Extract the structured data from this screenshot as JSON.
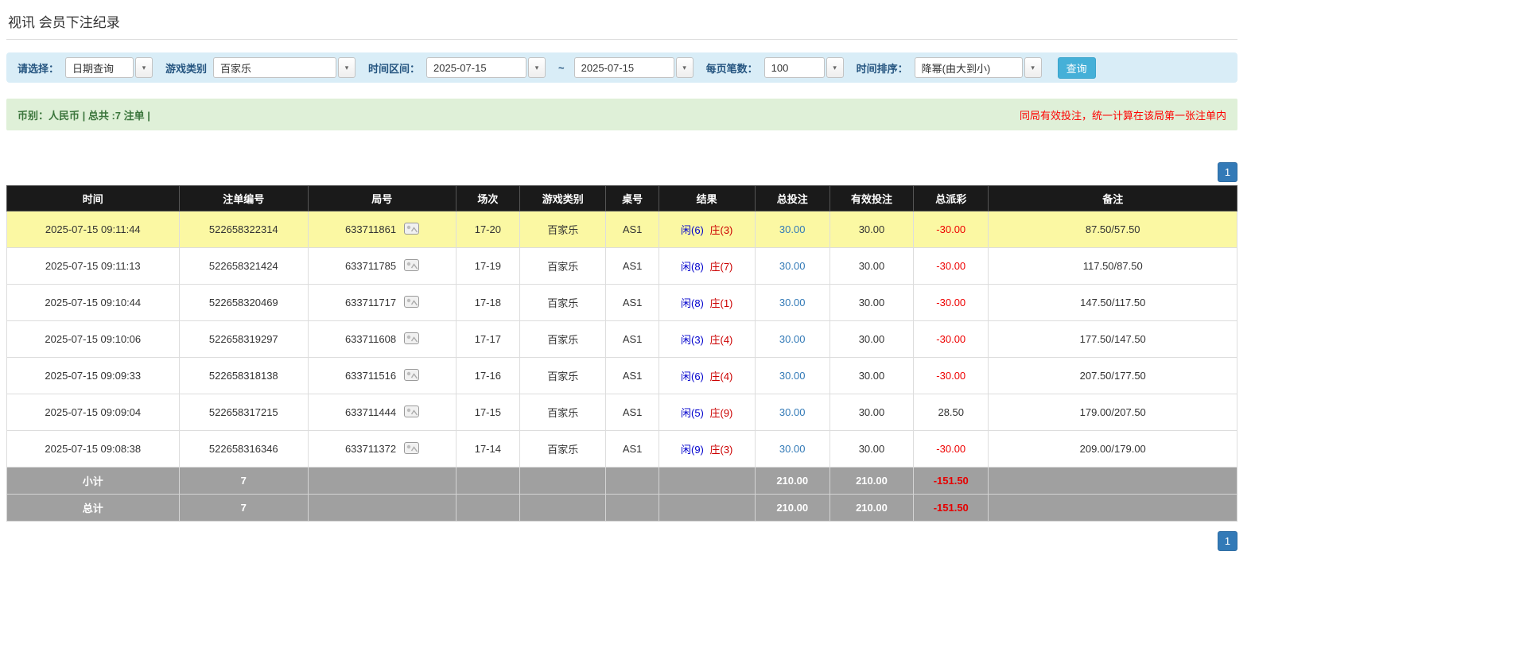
{
  "page": {
    "title": "视讯 会员下注纪录"
  },
  "icons": {
    "combo_arrow": "▾",
    "round_result_icon": "game-result-icon"
  },
  "filters": {
    "select_label": "请选择：",
    "select_value": "日期查询",
    "game_type_label": "游戏类别",
    "game_type_value": "百家乐",
    "date_range_label": "时间区间：",
    "date_from": "2025-07-15",
    "date_separator": "~",
    "date_to": "2025-07-15",
    "page_size_label": "每页笔数：",
    "page_size_value": "100",
    "sort_label": "时间排序：",
    "sort_value": "降幂(由大到小)",
    "search_button_label": "查询"
  },
  "summary_bar": {
    "left_text": "币别：人民币 | 总共 :7 注单 |",
    "right_text": "同局有效投注，统一计算在该局第一张注单内"
  },
  "pagination": {
    "top_page": "1",
    "bottom_page": "1"
  },
  "colors": {
    "filter_bar_bg": "#d9edf7",
    "summary_bar_bg": "#dff0d8",
    "summary_text_green": "#3c763d",
    "notice_red": "#ff0000",
    "header_bg": "#1a1a1a",
    "highlight_row": "#fbf8a3",
    "footer_gray": "#a0a0a0",
    "link_blue": "#337ab7",
    "player_blue": "#0000cc",
    "banker_red": "#cc0000",
    "negative_red": "#ee0000",
    "search_button_blue": "#45b0d8",
    "pagination_blue": "#337ab7"
  },
  "table": {
    "headers": [
      "时间",
      "注单编号",
      "局号",
      "场次",
      "游戏类别",
      "桌号",
      "结果",
      "总投注",
      "有效投注",
      "总派彩",
      "备注"
    ],
    "rows": [
      {
        "time": "2025-07-15 09:11:44",
        "bet_id": "522658322314",
        "round_id": "633711861",
        "session": "17-20",
        "game": "百家乐",
        "table_no": "AS1",
        "result_player": "闲(6)",
        "result_banker": "庄(3)",
        "total_bet": "30.00",
        "valid_bet": "30.00",
        "payout": "-30.00",
        "remark": "87.50/57.50",
        "highlight": true
      },
      {
        "time": "2025-07-15 09:11:13",
        "bet_id": "522658321424",
        "round_id": "633711785",
        "session": "17-19",
        "game": "百家乐",
        "table_no": "AS1",
        "result_player": "闲(8)",
        "result_banker": "庄(7)",
        "total_bet": "30.00",
        "valid_bet": "30.00",
        "payout": "-30.00",
        "remark": "117.50/87.50",
        "highlight": false
      },
      {
        "time": "2025-07-15 09:10:44",
        "bet_id": "522658320469",
        "round_id": "633711717",
        "session": "17-18",
        "game": "百家乐",
        "table_no": "AS1",
        "result_player": "闲(8)",
        "result_banker": "庄(1)",
        "total_bet": "30.00",
        "valid_bet": "30.00",
        "payout": "-30.00",
        "remark": "147.50/117.50",
        "highlight": false
      },
      {
        "time": "2025-07-15 09:10:06",
        "bet_id": "522658319297",
        "round_id": "633711608",
        "session": "17-17",
        "game": "百家乐",
        "table_no": "AS1",
        "result_player": "闲(3)",
        "result_banker": "庄(4)",
        "total_bet": "30.00",
        "valid_bet": "30.00",
        "payout": "-30.00",
        "remark": "177.50/147.50",
        "highlight": false
      },
      {
        "time": "2025-07-15 09:09:33",
        "bet_id": "522658318138",
        "round_id": "633711516",
        "session": "17-16",
        "game": "百家乐",
        "table_no": "AS1",
        "result_player": "闲(6)",
        "result_banker": "庄(4)",
        "total_bet": "30.00",
        "valid_bet": "30.00",
        "payout": "-30.00",
        "remark": "207.50/177.50",
        "highlight": false
      },
      {
        "time": "2025-07-15 09:09:04",
        "bet_id": "522658317215",
        "round_id": "633711444",
        "session": "17-15",
        "game": "百家乐",
        "table_no": "AS1",
        "result_player": "闲(5)",
        "result_banker": "庄(9)",
        "total_bet": "30.00",
        "valid_bet": "30.00",
        "payout": "28.50",
        "remark": "179.00/207.50",
        "highlight": false
      },
      {
        "time": "2025-07-15 09:08:38",
        "bet_id": "522658316346",
        "round_id": "633711372",
        "session": "17-14",
        "game": "百家乐",
        "table_no": "AS1",
        "result_player": "闲(9)",
        "result_banker": "庄(3)",
        "total_bet": "30.00",
        "valid_bet": "30.00",
        "payout": "-30.00",
        "remark": "209.00/179.00",
        "highlight": false
      }
    ],
    "footer_rows": [
      {
        "label": "小计",
        "count": "7",
        "total_bet": "210.00",
        "valid_bet": "210.00",
        "payout": "-151.50"
      },
      {
        "label": "总计",
        "count": "7",
        "total_bet": "210.00",
        "valid_bet": "210.00",
        "payout": "-151.50"
      }
    ]
  }
}
